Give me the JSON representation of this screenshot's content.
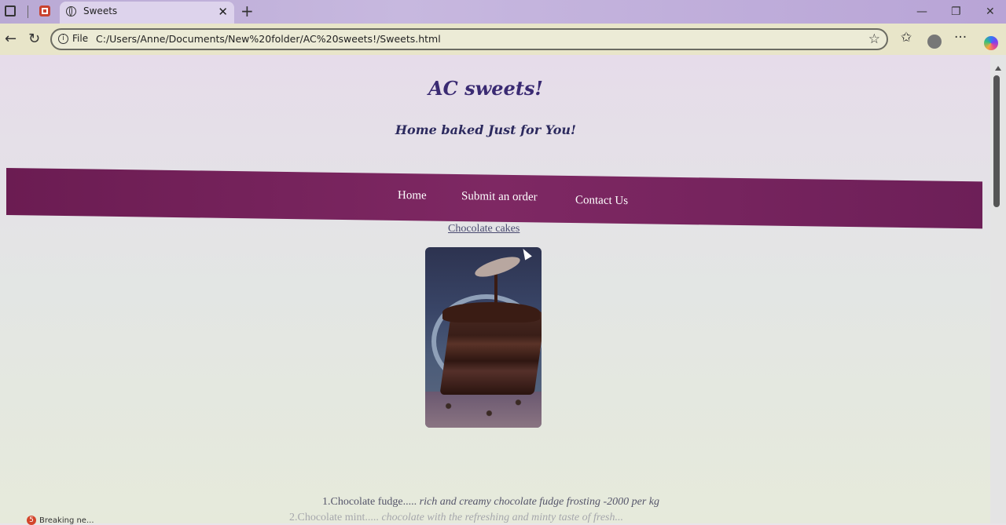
{
  "browser": {
    "tab_title": "Sweets",
    "tab_close": "✕",
    "new_tab": "+",
    "file_label": "File",
    "url": "C:/Users/Anne/Documents/New%20folder/AC%20sweets!/Sweets.html",
    "window_controls": [
      "—",
      "❐",
      "✕"
    ],
    "toolbar_icons": [
      "star-icon",
      "favorites-icon",
      "profile-icon",
      "more-icon",
      "copilot-icon"
    ],
    "more_label": "···"
  },
  "site": {
    "title": "AC sweets!",
    "tagline": "Home baked Just for You!"
  },
  "nav": {
    "items": [
      {
        "label": "Home"
      },
      {
        "label": "Submit an order"
      },
      {
        "label": "Contact Us"
      }
    ],
    "bar_color": "#7a2460"
  },
  "content": {
    "category_link": "Chocolate cakes",
    "image_alt": "Chocolate cake slice",
    "items": [
      {
        "name": "1.Chocolate fudge.....",
        "description": "rich and creamy chocolate fudge frosting",
        "price": "-2000 per kg"
      },
      {
        "name": "2.Chocolate mint.....",
        "description": "chocolate with the refreshing and minty taste of fresh..."
      }
    ]
  },
  "taskbar": {
    "badge": "5",
    "text": "Breaking ne..."
  }
}
